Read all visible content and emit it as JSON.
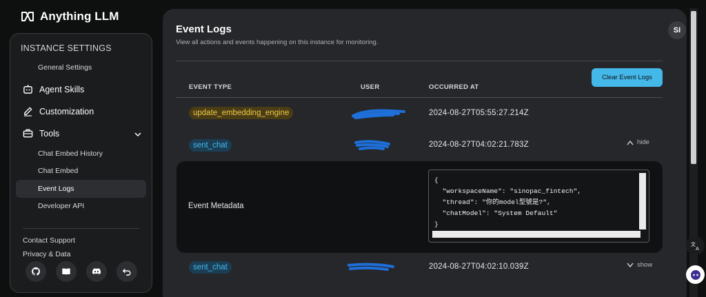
{
  "app": {
    "title": "Anything LLM"
  },
  "sidebar": {
    "section_title": "INSTANCE SETTINGS",
    "general_settings": "General Settings",
    "agent_skills": "Agent Skills",
    "customization": "Customization",
    "tools": "Tools",
    "tools_items": [
      "Chat Embed History",
      "Chat Embed",
      "Event Logs",
      "Developer API"
    ],
    "active_item": "Event Logs",
    "footer": {
      "contact_support": "Contact Support",
      "privacy": "Privacy & Data"
    },
    "footer_icons": [
      "github-icon",
      "docs-book-icon",
      "discord-icon",
      "undo-icon"
    ]
  },
  "page": {
    "title": "Event Logs",
    "description": "View all actions and events happening on this instance for monitoring.",
    "avatar_initials": "SI",
    "clear_button": "Clear Event Logs"
  },
  "table": {
    "columns": [
      "EVENT TYPE",
      "USER",
      "OCCURRED AT"
    ],
    "rows": [
      {
        "event": "update_embedding_engine",
        "user": "",
        "occurred_at": "2024-08-27T05:55:27.214Z",
        "toggle": ""
      },
      {
        "event": "sent_chat",
        "user": "",
        "occurred_at": "2024-08-27T04:02:21.783Z",
        "toggle": "hide"
      },
      {
        "event": "sent_chat",
        "user": "",
        "occurred_at": "2024-08-27T04:02:10.039Z",
        "toggle": "show"
      }
    ],
    "metadata_label": "Event Metadata",
    "metadata_code": "{\n  \"workspaceName\": \"sinopac_fintech\",\n  \"thread\": \"你的model型號是?\",\n  \"chatModel\": \"System Default\"\n}"
  },
  "colors": {
    "accent": "#45b8ea",
    "embed_badge_text": "#f0c94a",
    "chat_badge_text": "#45b8ea",
    "redaction": "#1e6fd9"
  }
}
